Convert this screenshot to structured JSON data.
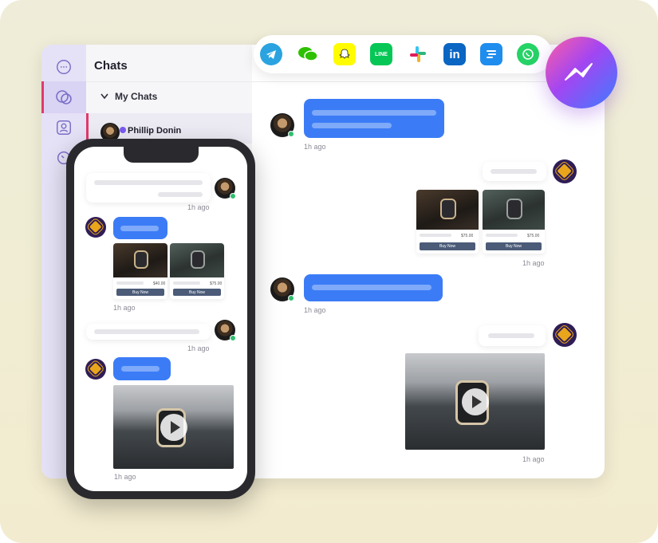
{
  "header": {
    "title": "Chats"
  },
  "chatlist": {
    "section_label": "My Chats",
    "active_contact": "Phillip Donin"
  },
  "desktop": {
    "timestamps": [
      "1h ago",
      "1h ago",
      "1h ago",
      "1h ago"
    ],
    "products": [
      {
        "price": "$75.00",
        "button": "Buy Now"
      },
      {
        "price": "$75.00",
        "button": "Buy Now"
      }
    ]
  },
  "phone": {
    "timestamps": [
      "1h ago",
      "1h ago",
      "1h ago",
      "1h ago"
    ],
    "products": [
      {
        "price": "$40.00",
        "button": "Buy Now"
      },
      {
        "price": "$75.00",
        "button": "Buy Now"
      }
    ]
  },
  "integrations": [
    "telegram-icon",
    "wechat-icon",
    "snapchat-icon",
    "line-icon",
    "slack-icon",
    "linkedin-icon",
    "intercom-icon",
    "whatsapp-icon"
  ],
  "integration_labels": {
    "line": "LINE",
    "linkedin": "in"
  },
  "colors": {
    "accent": "#3b7cf6",
    "active_marker": "#e03a6a",
    "rail": "#e5e1f6"
  }
}
